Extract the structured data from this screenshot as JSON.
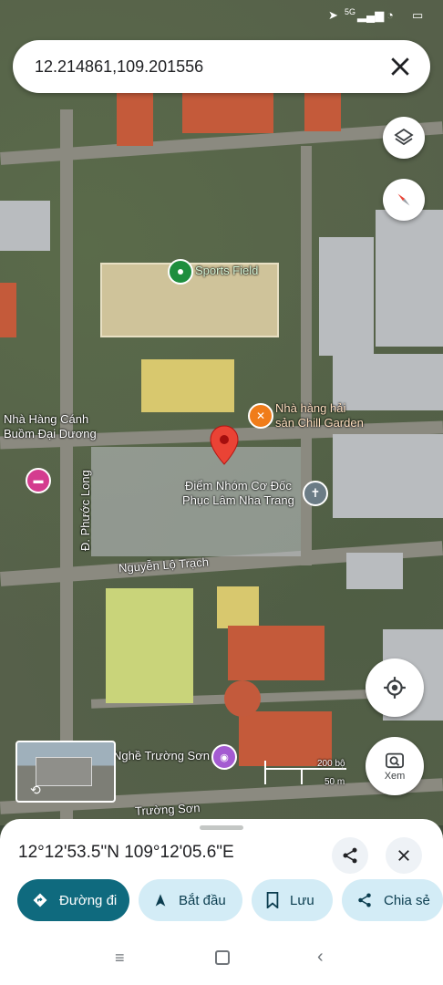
{
  "status_bar": {
    "network": "5G"
  },
  "search": {
    "value": "12.214861,109.201556"
  },
  "map": {
    "labels": {
      "sports_field": "Sports Field",
      "restaurant_1": "Nhà hàng hải\nsản Chill Garden",
      "restaurant_2": "Nhà Hàng Cánh\nBuồm Đại Dương",
      "church": "Điểm Nhóm Cơ Đốc\nPhục Lâm Nha Trang",
      "street_phuoc_long": "Đ. Phước Long",
      "street_nguyen_lo_trach": "Nguyễn Lộ Trạch",
      "street_truong_son": "Trường Sơn",
      "nghe_truong_son": "Nghề Trường Sơn"
    },
    "scale": {
      "top": "200 bộ",
      "bottom": "50 m"
    },
    "lens_label": "Xem"
  },
  "sheet": {
    "coords": "12°12'53.5\"N 109°12'05.6\"E",
    "buttons": {
      "directions": "Đường đi",
      "start": "Bắt đầu",
      "save": "Lưu",
      "share": "Chia sẻ"
    }
  },
  "colors": {
    "primary": "#0f6a7e",
    "chip": "#d3ecf6",
    "pin": "#ea4335"
  }
}
